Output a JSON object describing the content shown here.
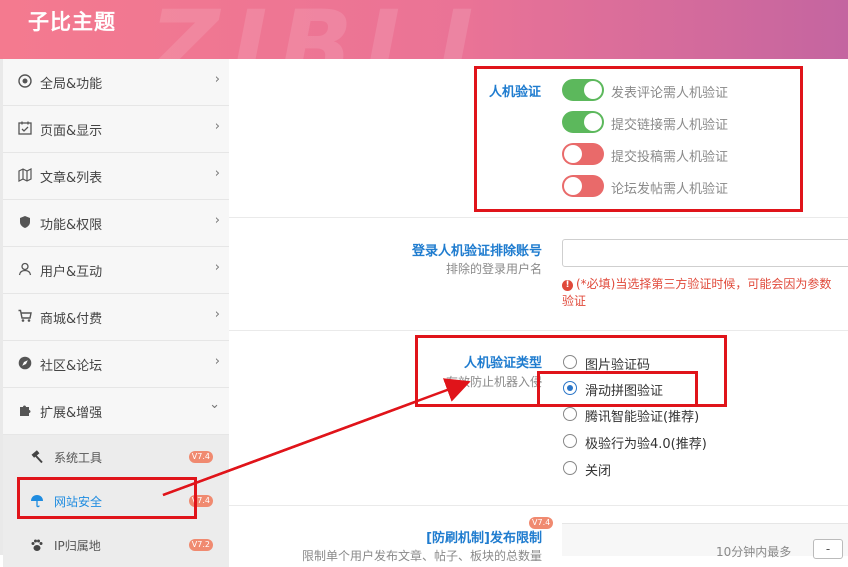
{
  "header": {
    "title": "子比主题",
    "watermark": "ZIBLL"
  },
  "sidebar": {
    "items": [
      {
        "label": "全局&功能",
        "icon": "target-icon"
      },
      {
        "label": "页面&显示",
        "icon": "calendar-check-icon"
      },
      {
        "label": "文章&列表",
        "icon": "map-icon"
      },
      {
        "label": "功能&权限",
        "icon": "shield-icon"
      },
      {
        "label": "用户&互动",
        "icon": "user-icon"
      },
      {
        "label": "商城&付费",
        "icon": "cart-icon"
      },
      {
        "label": "社区&论坛",
        "icon": "compass-icon"
      },
      {
        "label": "扩展&增强",
        "icon": "puzzle-icon"
      }
    ],
    "chevron_right": "›",
    "chevron_down": "⌄",
    "subitems": [
      {
        "label": "系统工具",
        "badge": "V7.4",
        "icon": "hammer-icon"
      },
      {
        "label": "网站安全",
        "badge": "V7.4",
        "icon": "umbrella-icon",
        "active": true
      },
      {
        "label": "IP归属地",
        "badge": "V7.2",
        "icon": "paw-icon"
      }
    ]
  },
  "captcha_section": {
    "label": "人机验证",
    "switches": [
      {
        "label": "发表评论需人机验证",
        "on": true
      },
      {
        "label": "提交链接需人机验证",
        "on": true
      },
      {
        "label": "提交投稿需人机验证",
        "on": false
      },
      {
        "label": "论坛发帖需人机验证",
        "on": false
      }
    ]
  },
  "exclude_section": {
    "label": "登录人机验证排除账号",
    "desc": "排除的登录用户名",
    "input_value": "",
    "warning_line1": "(*必填)当选择第三方验证时候，可能会因为参数",
    "warning_line2": "验证"
  },
  "captcha_type_section": {
    "label": "人机验证类型",
    "desc": "有效防止机器入侵",
    "options": [
      {
        "label": "图片验证码",
        "checked": false
      },
      {
        "label": "滑动拼图验证",
        "checked": true
      },
      {
        "label": "腾讯智能验证(推荐)",
        "checked": false
      },
      {
        "label": "极验行为验4.0(推荐)",
        "checked": false
      },
      {
        "label": "关闭",
        "checked": false
      }
    ]
  },
  "limit_section": {
    "label": "[防刷机制]发布限制",
    "badge": "V7.4",
    "desc": "限制单个用户发布文章、帖子、板块的总数量",
    "right_text": "10分钟内最多",
    "button_label": "-"
  },
  "colors": {
    "accent": "#1f7ccf",
    "switch_on": "#5cb85c",
    "switch_off": "#e96a6a",
    "annotation": "#e0141a"
  }
}
